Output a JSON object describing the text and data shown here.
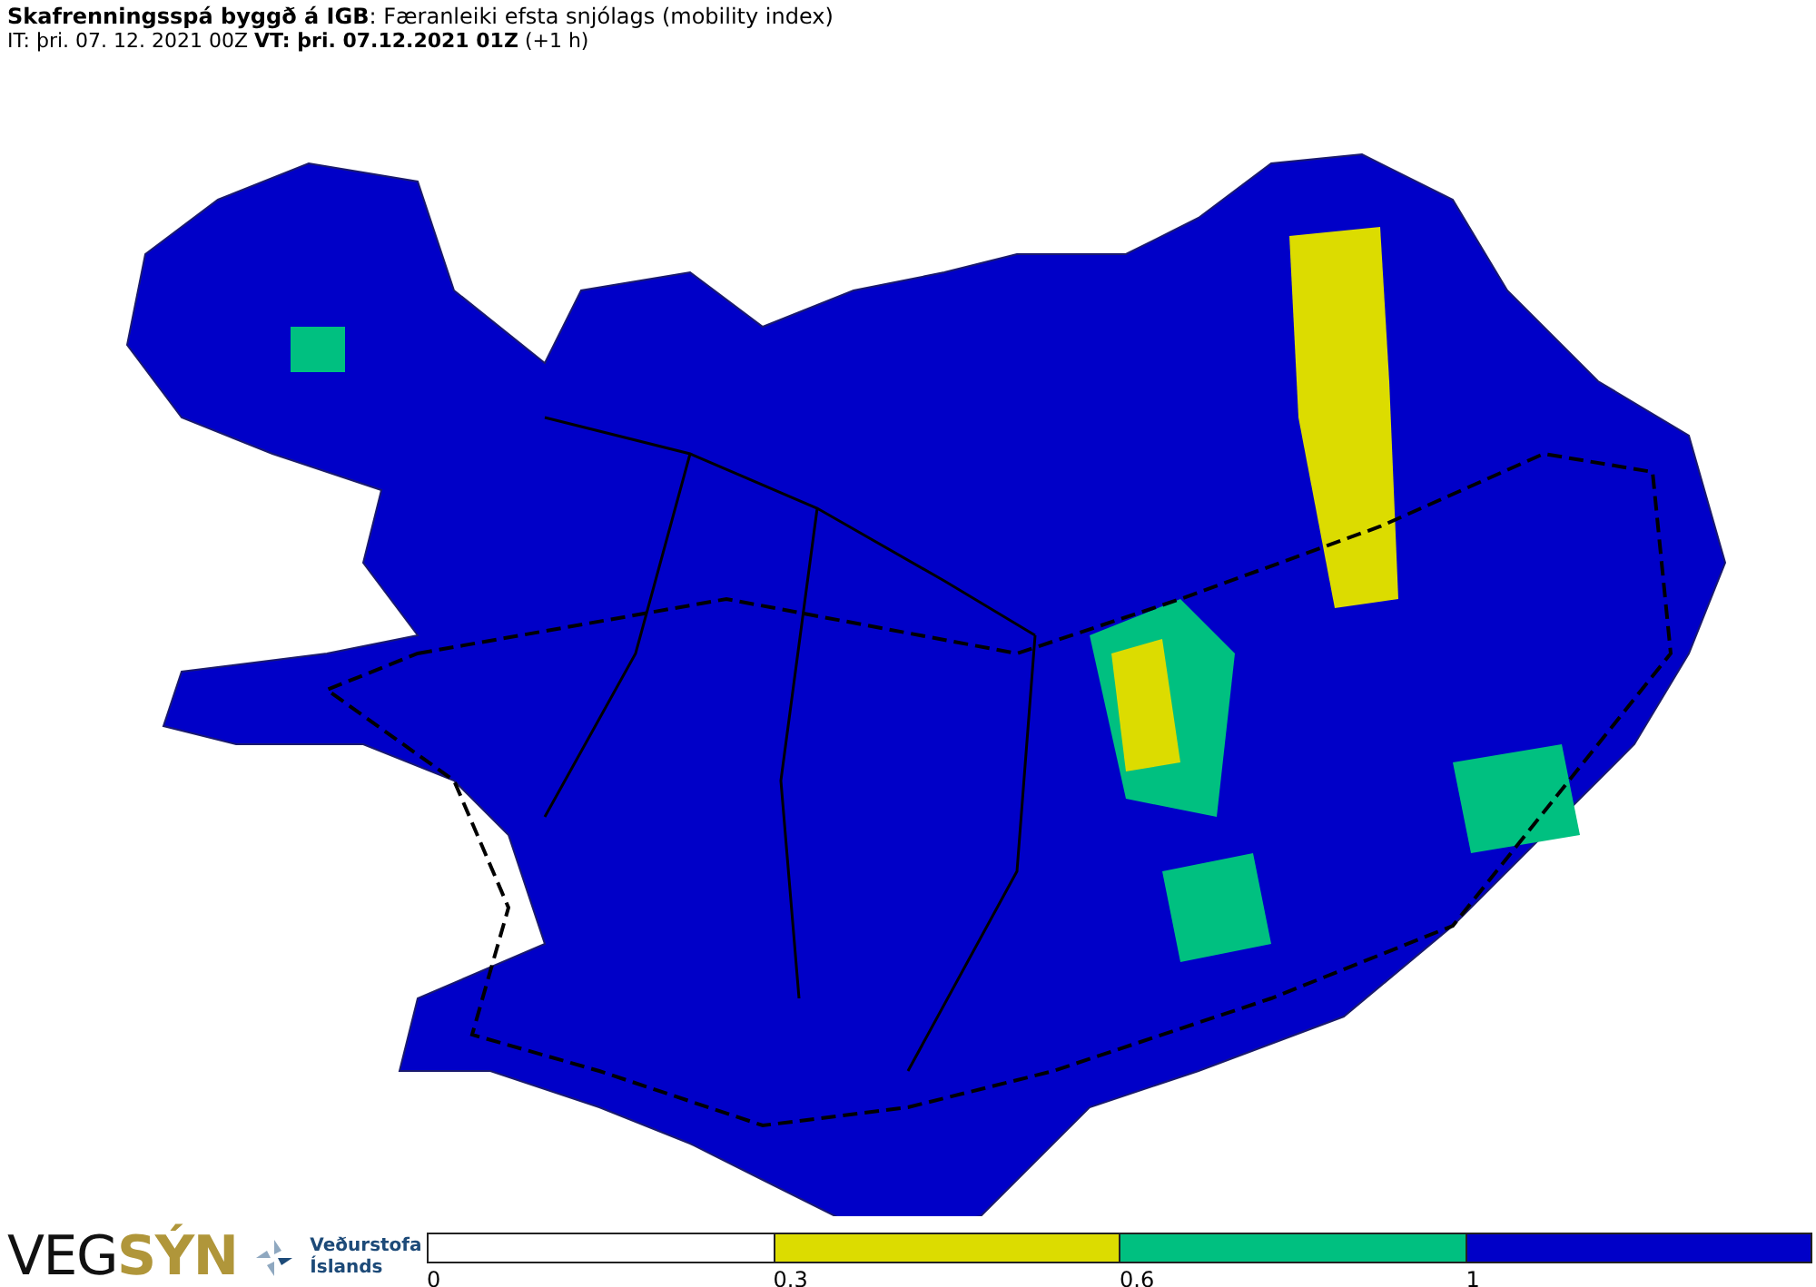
{
  "header": {
    "title": "**Skafrenningsspá byggð á IGB**: Færanleiki efsta snjólags (mobility index)",
    "subtitle": "IT: þri. 07. 12. 2021 00Z **VT: þri. 07.12.2021 01Z** (+1 h)"
  },
  "logos": {
    "vegsyn_part1": "VEG",
    "vegsyn_part2": "SÝN",
    "agency_line1": "Veðurstofa",
    "agency_line2": "Íslands"
  },
  "legend": {
    "segments": [
      {
        "color": "#ffffff"
      },
      {
        "color": "#dcdc00"
      },
      {
        "color": "#00c080"
      },
      {
        "color": "#0000c8"
      }
    ],
    "ticks": [
      "0",
      "0.3",
      "0.6",
      "1"
    ]
  }
}
